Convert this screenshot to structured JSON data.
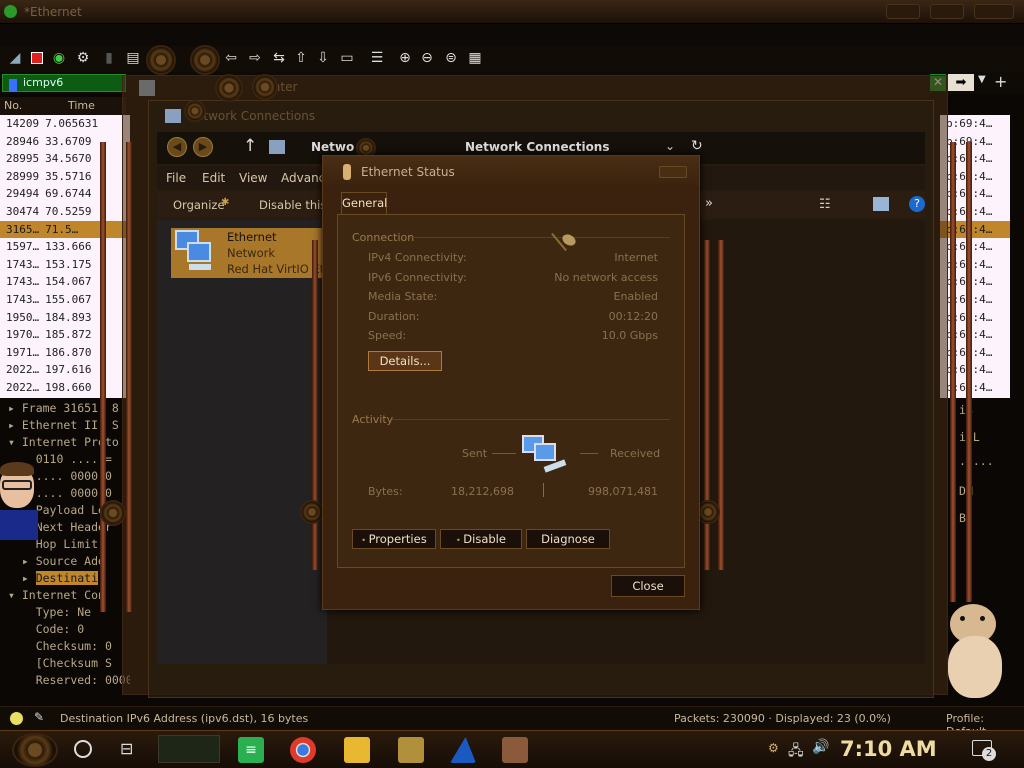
{
  "wireshark": {
    "title": "*Ethernet",
    "filter_text": "icmpv6",
    "columns": {
      "no": "No.",
      "time": "Time"
    },
    "packet_rows": [
      {
        "no": "14209",
        "time": "7.065631"
      },
      {
        "no": "28946",
        "time": "33.6709"
      },
      {
        "no": "28995",
        "time": "34.5670"
      },
      {
        "no": "28999",
        "time": "35.5716"
      },
      {
        "no": "29494",
        "time": "69.6744"
      },
      {
        "no": "30474",
        "time": "70.5259"
      },
      {
        "no": "3165…",
        "time": "71.5…"
      },
      {
        "no": "1597…",
        "time": "133.666"
      },
      {
        "no": "1743…",
        "time": "153.175"
      },
      {
        "no": "1743…",
        "time": "154.067"
      },
      {
        "no": "1743…",
        "time": "155.067"
      },
      {
        "no": "1950…",
        "time": "184.893"
      },
      {
        "no": "1970…",
        "time": "185.872"
      },
      {
        "no": "1971…",
        "time": "186.870"
      },
      {
        "no": "2022…",
        "time": "197.616"
      },
      {
        "no": "2022…",
        "time": "198.660"
      }
    ],
    "packet_rows_right": [
      "b:69:4…",
      "b:69:4…",
      "b:69:4…",
      "b:69:4…",
      "b:69:4…",
      "b:69:4…",
      "b:69:4…",
      "b:69:4…",
      "b:69:4…",
      "b:69:4…",
      "b:69:4…",
      "b:69:4…",
      "b:69:4…",
      "b:69:4…",
      "b:69:4…",
      "b:69:4…"
    ],
    "detail_rows": [
      {
        "prefix": "▸ ",
        "text": "Frame 31651: 8"
      },
      {
        "prefix": "▸ ",
        "text": "Ethernet II, S"
      },
      {
        "prefix": "▾ ",
        "text": "Internet Proto"
      },
      {
        "prefix": "    ",
        "text": "0110 .... ="
      },
      {
        "prefix": "  ▸ ",
        "text": ".... 0000 0"
      },
      {
        "prefix": "    ",
        "text": ".... 0000 0"
      },
      {
        "prefix": "    ",
        "text": "Payload Len"
      },
      {
        "prefix": "    ",
        "text": "Next Header"
      },
      {
        "prefix": "    ",
        "text": "Hop Limit:"
      },
      {
        "prefix": "  ▸ ",
        "text": "Source Add"
      },
      {
        "prefix": "  ▸ ",
        "text": "Destinati",
        "highlight": true
      },
      {
        "prefix": "▾ ",
        "text": "Internet Con"
      },
      {
        "prefix": "    ",
        "text": "Type: Ne"
      },
      {
        "prefix": "    ",
        "text": "Code: 0"
      },
      {
        "prefix": "    ",
        "text": "Checksum: 0"
      },
      {
        "prefix": "    ",
        "text": "[Checksum S"
      },
      {
        "prefix": "    ",
        "text": "Reserved: 00000"
      }
    ],
    "hex_right": [
      "iB",
      "i L",
      "·····",
      "DM",
      "B"
    ],
    "status": {
      "field": "Destination IPv6 Address (ipv6.dst), 16 bytes",
      "packets": "Packets: 230090 · Displayed: 23 (0.0%)",
      "profile": "Profile: Default"
    }
  },
  "nsc_window": {
    "title": "Center"
  },
  "network_connections": {
    "title": "Network Connections",
    "nav_title": "Network Connections",
    "nav_prefix": "Netwo",
    "menu": [
      "File",
      "Edit",
      "View",
      "Advance"
    ],
    "cmd_organize": "Organize",
    "cmd_disable": "Disable this n",
    "adapter": {
      "name": "Ethernet",
      "network": "Network",
      "device": "Red Hat VirtIO Eth"
    }
  },
  "ethernet_status": {
    "title": "Ethernet Status",
    "tab": "General",
    "connection_header": "Connection",
    "rows": [
      {
        "label": "IPv4 Connectivity:",
        "value": "Internet"
      },
      {
        "label": "IPv6 Connectivity:",
        "value": "No network access"
      },
      {
        "label": "Media State:",
        "value": "Enabled"
      },
      {
        "label": "Duration:",
        "value": "00:12:20"
      },
      {
        "label": "Speed:",
        "value": "10.0 Gbps"
      }
    ],
    "details_button": "Details...",
    "activity_header": "Activity",
    "sent_label": "Sent",
    "received_label": "Received",
    "bytes_label": "Bytes:",
    "bytes_sent": "18,212,698",
    "bytes_received": "998,071,481",
    "properties_button": "Properties",
    "disable_button": "Disable",
    "diagnose_button": "Diagnose",
    "close_button": "Close"
  },
  "taskbar": {
    "clock": "7:10 AM",
    "notification_count": "2"
  },
  "colors": {
    "accent": "#c0862c",
    "dialog_bg": "#3e2710",
    "filter_green": "#0c5c14"
  }
}
